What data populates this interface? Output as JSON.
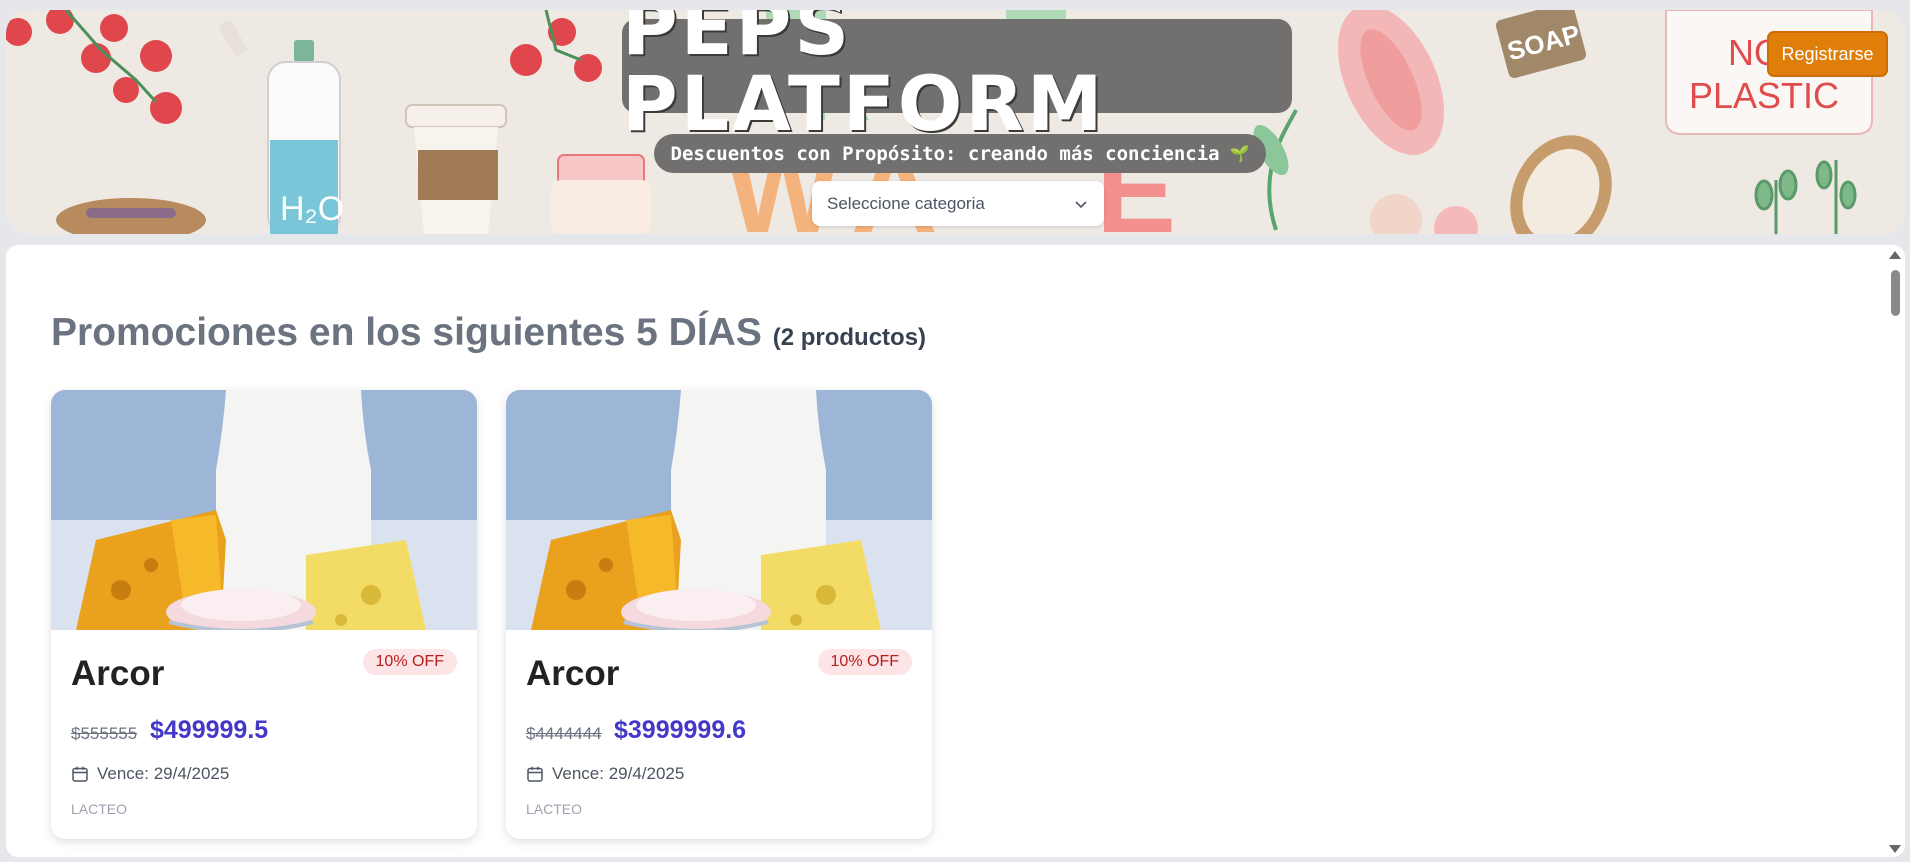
{
  "header": {
    "title": "PEPS PLATFORM",
    "subtitle": "Descuentos con Propósito: creando más conciencia",
    "subtitle_emoji": "🌱",
    "category_select": {
      "value": "Seleccione categoria"
    },
    "register_label": "Registrarse",
    "accent_color": "#e07e0a"
  },
  "main": {
    "section_title": "Promociones en los siguientes 5 DÍAS",
    "section_count": "(2 productos)",
    "products": [
      {
        "name": "Arcor",
        "discount": "10% OFF",
        "old_price": "$555555",
        "new_price": "$499999.5",
        "expiry": "Vence: 29/4/2025",
        "category": "LACTEO"
      },
      {
        "name": "Arcor",
        "discount": "10% OFF",
        "old_price": "$4444444",
        "new_price": "$3999999.6",
        "expiry": "Vence: 29/4/2025",
        "category": "LACTEO"
      }
    ]
  },
  "icons": {
    "calendar": "calendar-icon",
    "chevron": "chevron-down-icon"
  }
}
